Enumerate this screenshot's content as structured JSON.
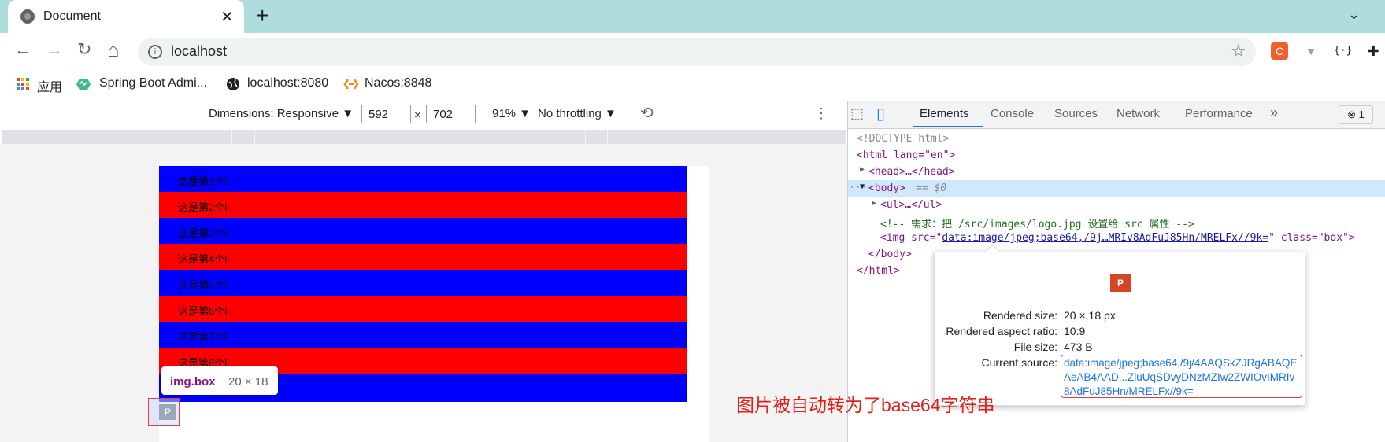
{
  "tab": {
    "title": "Document",
    "close_glyph": "✕",
    "new_tab_glyph": "+",
    "menu_glyph": "⌄"
  },
  "nav": {
    "back_glyph": "←",
    "forward_glyph": "→",
    "reload_glyph": "↻",
    "home_glyph": "⌂",
    "info_glyph": "i",
    "star_glyph": "☆"
  },
  "omnibox": {
    "url": "localhost"
  },
  "extensions": [
    {
      "name": "c-extension-icon",
      "glyph": "C",
      "color": "#f25f2c"
    },
    {
      "name": "v-extension-icon",
      "glyph": "▼",
      "color": "#9e9e9e"
    },
    {
      "name": "json-extension-icon",
      "glyph": "{·}",
      "color": "#ffffff"
    },
    {
      "name": "puzzle-extension-icon",
      "glyph": "✚",
      "color": "#ffffff"
    }
  ],
  "bookmarks": [
    {
      "label": "应用",
      "icon": "apps-grid-icon",
      "color": "#ea4335"
    },
    {
      "label": "Spring Boot Admi...",
      "icon": "spring-boot-admin-icon",
      "color": "#3cba8a"
    },
    {
      "label": "localhost:8080",
      "icon": "globe-icon",
      "color": "#202124"
    },
    {
      "label": "Nacos:8848",
      "icon": "nacos-icon",
      "color": "#f58b1f"
    }
  ],
  "device_toolbar": {
    "dimensions": "Dimensions: Responsive ▼",
    "width": "592",
    "times": "×",
    "height": "702",
    "zoom": "91% ▼",
    "throttling": "No throttling ▼",
    "rotate_glyph": "⟲",
    "more_glyph": "⋮"
  },
  "list_items": [
    {
      "text": "这是第1个li",
      "color": "#0000ff"
    },
    {
      "text": "这是第2个li",
      "color": "#ff0000"
    },
    {
      "text": "这是第3个li",
      "color": "#0000ff"
    },
    {
      "text": "这是第4个li",
      "color": "#ff0000"
    },
    {
      "text": "这是第5个li",
      "color": "#0000ff"
    },
    {
      "text": "这是第6个li",
      "color": "#ff0000"
    },
    {
      "text": "这是第7个li",
      "color": "#0000ff"
    },
    {
      "text": "这是第8个li",
      "color": "#ff0000"
    },
    {
      "text": "",
      "color": "#0000ff"
    }
  ],
  "element_tooltip": {
    "name": "img.box",
    "size": "20 × 18"
  },
  "page_img_glyph": "P",
  "devtools": {
    "inspect_glyph": "⬚",
    "device_glyph": "▯",
    "tabs": [
      "Elements",
      "Console",
      "Sources",
      "Network",
      "Performance"
    ],
    "more_tabs": "»",
    "error_badge": "⊗ 1",
    "dom": {
      "doctype": "<!DOCTYPE html>",
      "html_open": "<html lang=\"en\">",
      "head": "<head>…</head>",
      "body_dots": "···",
      "body_open": "<body>",
      "body_eq": "== $0",
      "ul": "<ul>…</ul>",
      "comment": "<!-- 需求：把 /src/images/logo.jpg 设置给 src 属性 -->",
      "img_open": "<img src=\"",
      "img_src": "data:image/jpeg;base64,/9j…MRIv8AdFuJ85Hn/MRELFx//9k=",
      "img_close": "\" class=\"box\">",
      "body_close": "</body>",
      "html_close": "</html>"
    },
    "popover": {
      "icon_glyph": "P",
      "rows": [
        {
          "label": "Rendered size:",
          "value": "20 × 18 px"
        },
        {
          "label": "Rendered aspect ratio:",
          "value": "10:9"
        },
        {
          "label": "File size:",
          "value": "473 B"
        },
        {
          "label": "Current source:",
          "value": ""
        }
      ],
      "current_source": "data:image/jpeg;base64,/9j/4AAQSkZJRgABAQEAeAB4AAD...ZluUqSDvyDNzMZIw2ZWIOvIMRIv8AdFuJ85Hn/MRELFx//9k="
    }
  },
  "annotation": "图片被自动转为了base64字符串"
}
